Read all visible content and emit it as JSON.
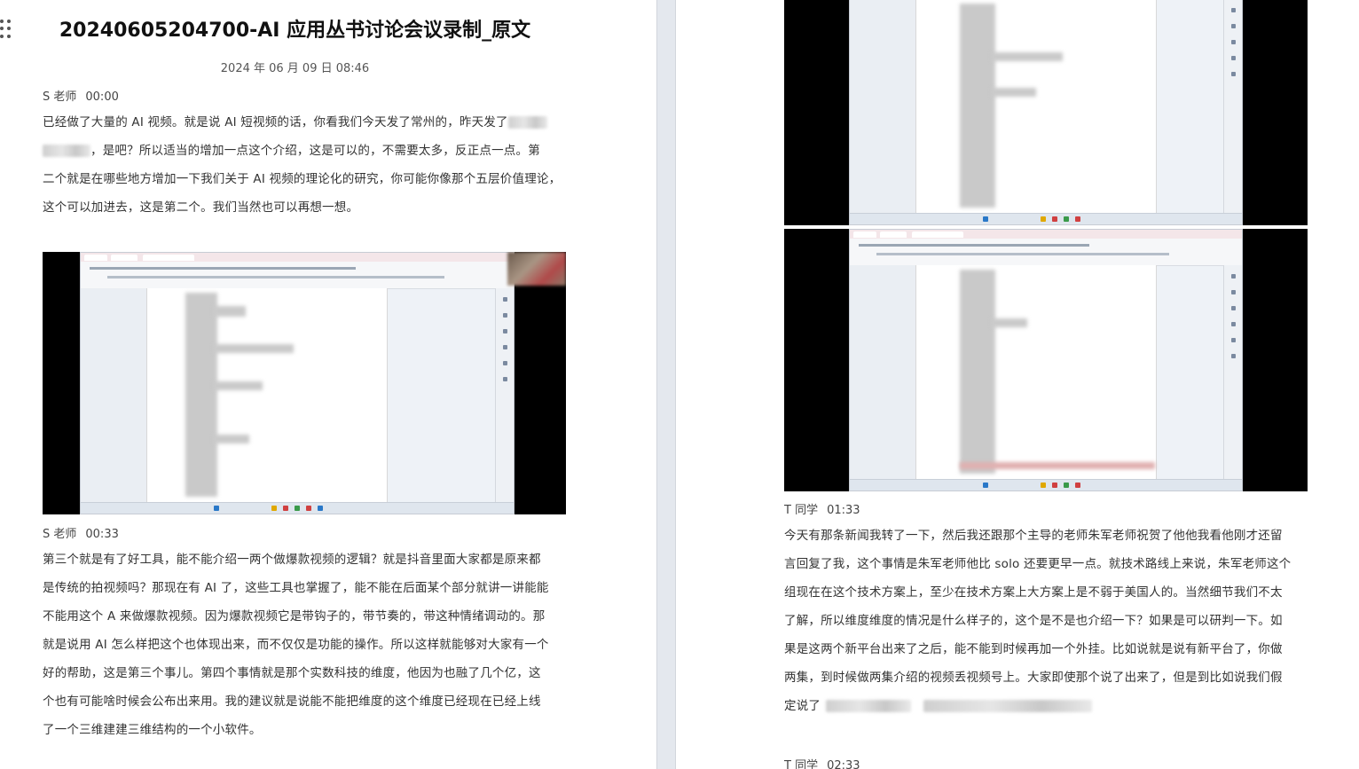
{
  "document": {
    "title": "20240605204700-AI 应用丛书讨论会议录制_原文",
    "date": "2024 年 06 月 09 日 08:46"
  },
  "left_page": {
    "segments": [
      {
        "speaker": "S 老师",
        "time": "00:00",
        "lines": [
          "已经做了大量的 AI 视频。就是说 AI 短视频的话，你看我们今天发了常州的，昨天发了",
          "，是吧？所以适当的增加一点这个介绍，这是可以的，不需要太多，反正点一点。第",
          "二个就是在哪些地方增加一下我们关于 AI 视频的理论化的研究，你可能你像那个五层价值理论，",
          "这个可以加进去，这是第二个。我们当然也可以再想一想。"
        ]
      },
      {
        "speaker": "S 老师",
        "time": "00:33",
        "lines": [
          "第三个就是有了好工具，能不能介绍一两个做爆款视频的逻辑？就是抖音里面大家都是原来都",
          "是传统的拍视频吗？那现在有 AI 了，这些工具也掌握了，能不能在后面某个部分就讲一讲能能",
          "不能用这个 A 来做爆款视频。因为爆款视频它是带钩子的，带节奏的，带这种情绪调动的。那",
          "就是说用 AI 怎么样把这个也体现出来，而不仅仅是功能的操作。所以这样就能够对大家有一个",
          "好的帮助，这是第三个事儿。第四个事情就是那个实数科技的维度，他因为也融了几个亿，这",
          "个也有可能啥时候会公布出来用。我的建议就是说能不能把维度的这个维度已经现在已经上线",
          "了一个三维建建三维结构的一个小软件。"
        ]
      }
    ]
  },
  "right_page": {
    "segments": [
      {
        "speaker": "T 同学",
        "time": "01:33",
        "lines": [
          "今天有那条新闻我转了一下，然后我还跟那个主导的老师朱军老师祝贺了他他我看他刚才还留",
          "言回复了我，这个事情是朱军老师他比 solo 还要更早一点。就技术路线上来说，朱军老师这个",
          "组现在在这个技术方案上，至少在技术方案上大方案上是不弱于美国人的。当然细节我们不太",
          "了解，所以维度维度的情况是什么样子的，这个是不是也介绍一下？如果是可以研判一下。如",
          "果是这两个新平台出来了之后，能不能到时候再加一个外挂。比如说就是说有新平台了，你做",
          "两集，到时候做两集介绍的视频丢视频号上。大家即使那个说了出来了，但是到比如说我们假",
          "定说了"
        ]
      },
      {
        "speaker": "T 同学",
        "time": "02:33",
        "lines": []
      }
    ]
  },
  "screenshots": {
    "left_embedded": "document-editor-screenshot",
    "right_top": "document-editor-screenshot",
    "right_bottom": "document-editor-screenshot"
  },
  "colors": {
    "gutter": "#e4e8ee",
    "title": "#111111",
    "body_text": "#333333"
  }
}
